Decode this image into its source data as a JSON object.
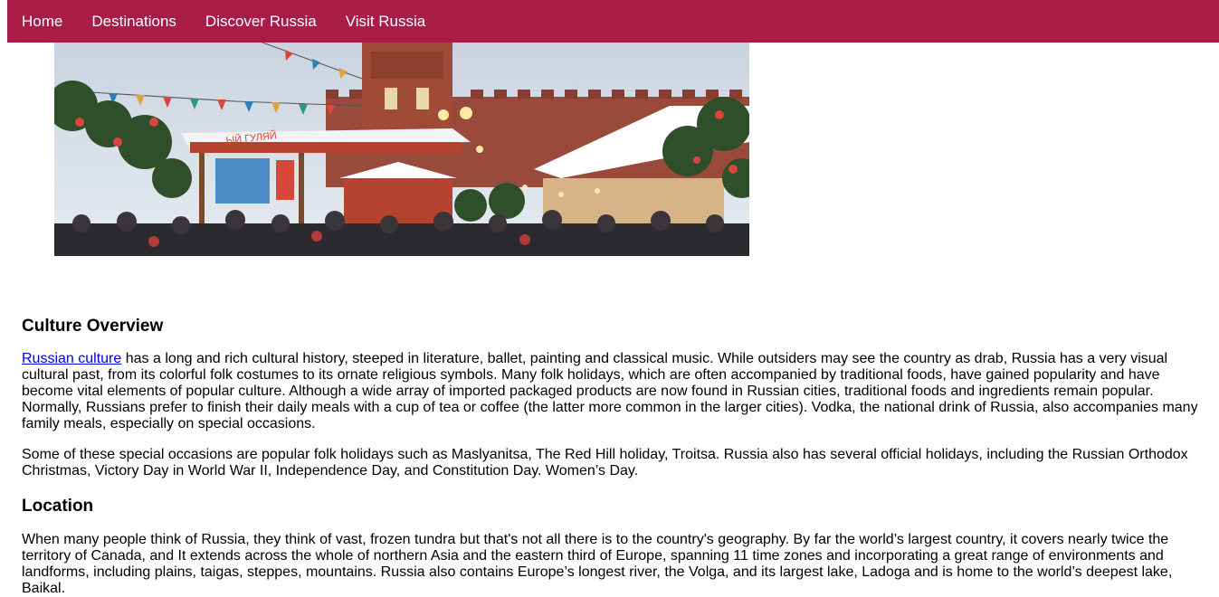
{
  "nav": {
    "items": [
      "Home",
      "Destinations",
      "Discover Russia",
      "Visit Russia"
    ]
  },
  "colors": {
    "nav_background": "#a91c48",
    "link": "#0000ee"
  },
  "sections": {
    "culture": {
      "heading": "Culture Overview",
      "link_text": "Russian culture",
      "paragraph1_rest": " has a long and rich cultural history, steeped in literature, ballet, painting and classical music. While outsiders may see the country as drab, Russia has a very visual cultural past, from its colorful folk costumes to its ornate religious symbols. Many folk holidays, which are often accompanied by traditional foods, have gained popularity and have become vital elements of popular culture. Although a wide array of imported packaged products are now found in Russian cities, traditional foods and ingredients remain popular. Normally, Russians prefer to finish their daily meals with a cup of tea or coffee (the latter more common in the larger cities). Vodka, the national drink of Russia, also accompanies many family meals, especially on special occasions.",
      "paragraph2": "Some of these special occasions are popular folk holidays such as Maslyanitsa, The Red Hill holiday, Troitsa. Russia also has several official holidays, including the Russian Orthodox Christmas, Victory Day in World War II, Independence Day, and Constitution Day. Women’s Day."
    },
    "location": {
      "heading": "Location",
      "paragraph1": "When many people think of Russia, they think of vast, frozen tundra but that's not all there is to the country's geography. By far the world’s largest country, it covers nearly twice the territory of Canada, and It extends across the whole of northern Asia and the eastern third of Europe, spanning 11 time zones and incorporating a great range of environments and landforms, including plains, taigas, steppes, mountains. Russia also contains Europe’s longest river, the Volga, and its largest lake, Ladoga and is home to the world’s deepest lake, Baikal."
    }
  }
}
